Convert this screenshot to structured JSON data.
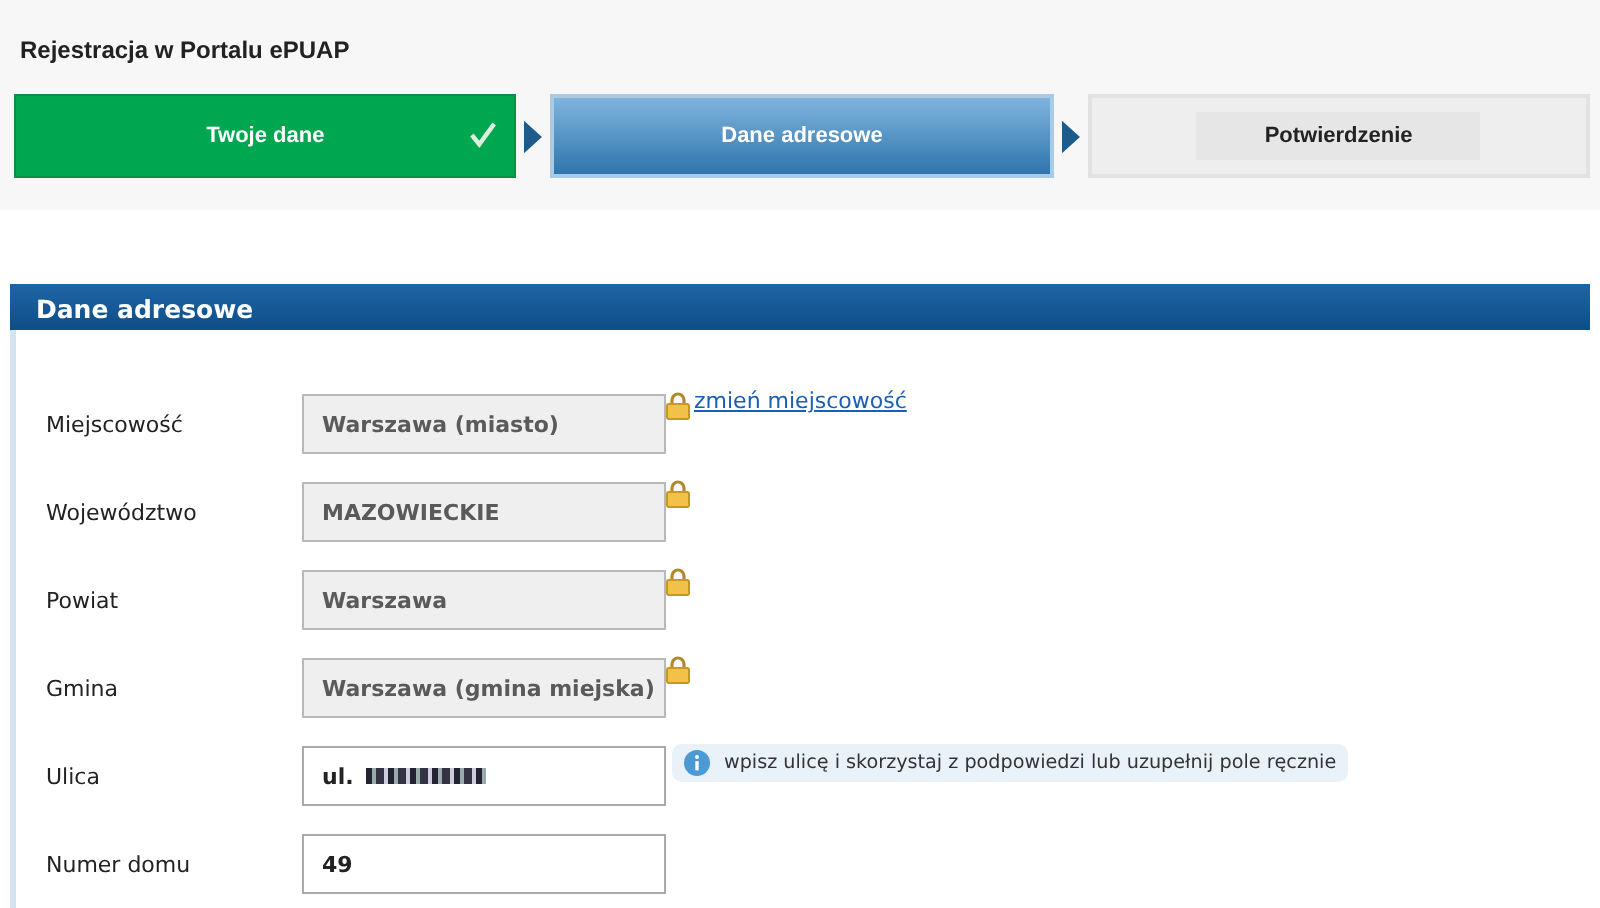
{
  "page_title": "Rejestracja w Portalu ePUAP",
  "steps": [
    {
      "label": "Twoje dane",
      "completed": true,
      "selected": false
    },
    {
      "label": "Dane adresowe",
      "completed": false,
      "selected": true
    },
    {
      "label": "Potwierdzenie",
      "completed": false,
      "selected": false
    }
  ],
  "section": {
    "title": "Dane adresowe"
  },
  "fields": [
    {
      "label": "Miejscowość",
      "value": "Warszawa (miasto)",
      "locked": true,
      "link": "zmień miejscowość"
    },
    {
      "label": "Województwo",
      "value": "MAZOWIECKIE",
      "locked": true
    },
    {
      "label": "Powiat",
      "value": "Warszawa",
      "locked": true
    },
    {
      "label": "Gmina",
      "value": "Warszawa (gmina miejska)",
      "locked": true
    },
    {
      "label": "Ulica",
      "value": "ul.",
      "locked": false,
      "redacted": true,
      "hint": "wpisz ulicę i skorzystaj z podpowiedzi lub uzupełnij pole ręcznie"
    },
    {
      "label": "Numer domu",
      "value": "49",
      "locked": false
    }
  ]
}
